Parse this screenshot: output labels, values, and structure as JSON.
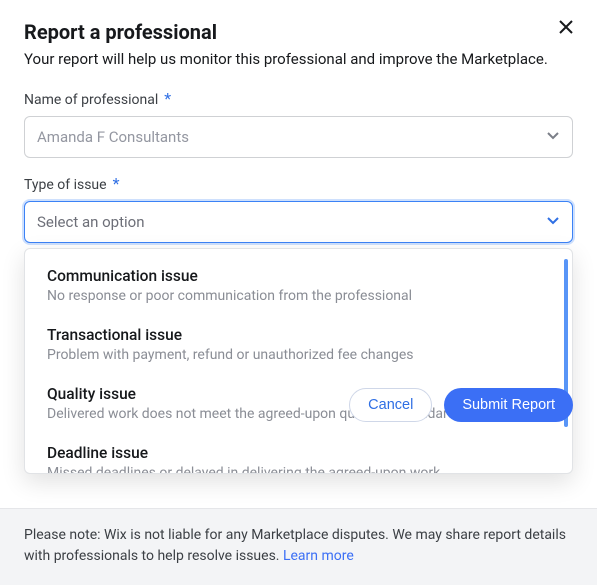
{
  "header": {
    "title": "Report a professional",
    "subtitle": "Your report will help us monitor this professional and improve the Marketplace."
  },
  "fields": {
    "name": {
      "label": "Name of professional",
      "value": "Amanda F Consultants"
    },
    "issue": {
      "label": "Type of issue",
      "placeholder": "Select an option",
      "options": [
        {
          "title": "Communication issue",
          "desc": "No response or poor communication from the professional"
        },
        {
          "title": "Transactional issue",
          "desc": "Problem with payment, refund or unauthorized fee changes"
        },
        {
          "title": "Quality issue",
          "desc": "Delivered work does not meet the agreed-upon quality or standards"
        },
        {
          "title": "Deadline issue",
          "desc": "Missed deadlines or delayed in delivering the agreed-upon work"
        }
      ]
    }
  },
  "actions": {
    "cancel": "Cancel",
    "submit": "Submit Report"
  },
  "footer": {
    "note_prefix": "Please note: Wix is not liable for any Marketplace disputes. We may share report details with professionals to help resolve issues. ",
    "learn_more": "Learn more"
  },
  "required_marker": "*"
}
